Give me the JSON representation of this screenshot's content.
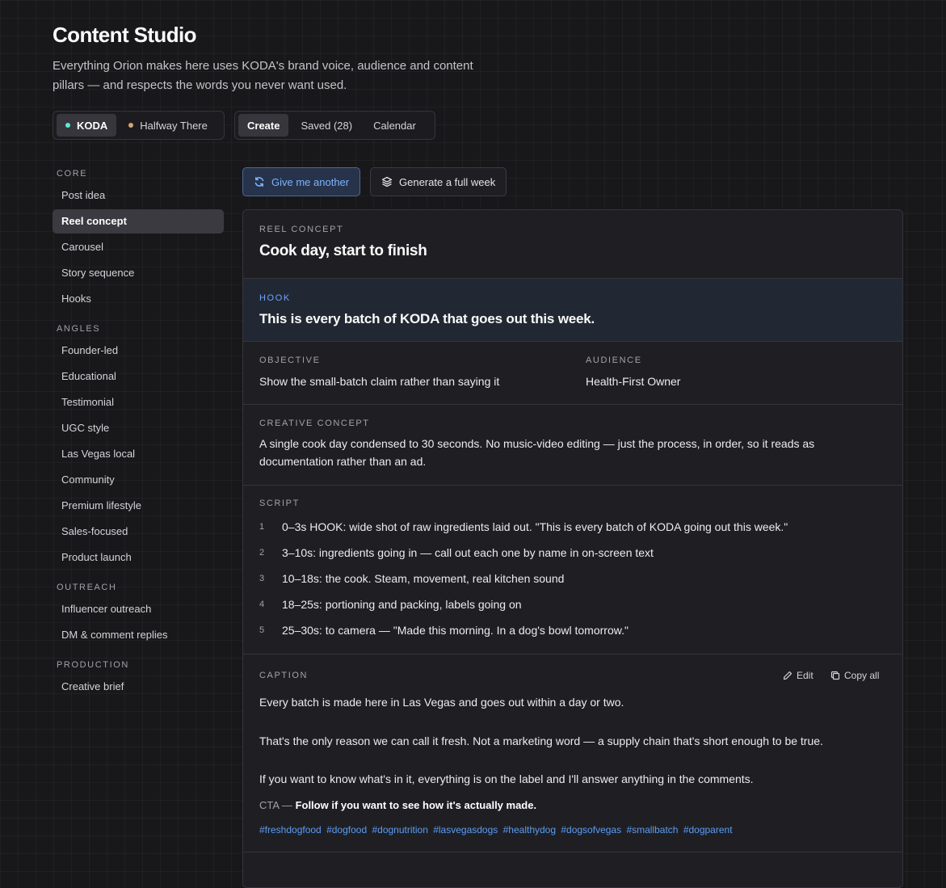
{
  "header": {
    "title": "Content Studio",
    "subtitle": "Everything Orion makes here uses KODA's brand voice, audience and content pillars — and respects the words you never want used."
  },
  "brands": [
    {
      "label": "KODA",
      "dot_color": "#5eead4",
      "active": true
    },
    {
      "label": "Halfway There",
      "dot_color": "#d4a574",
      "active": false
    }
  ],
  "view_tabs": [
    {
      "label": "Create",
      "active": true
    },
    {
      "label": "Saved (28)",
      "active": false
    },
    {
      "label": "Calendar",
      "active": false
    }
  ],
  "sidebar": {
    "groups": [
      {
        "heading": "CORE",
        "items": [
          {
            "label": "Post idea",
            "active": false
          },
          {
            "label": "Reel concept",
            "active": true
          },
          {
            "label": "Carousel",
            "active": false
          },
          {
            "label": "Story sequence",
            "active": false
          },
          {
            "label": "Hooks",
            "active": false
          }
        ]
      },
      {
        "heading": "ANGLES",
        "items": [
          {
            "label": "Founder-led",
            "active": false
          },
          {
            "label": "Educational",
            "active": false
          },
          {
            "label": "Testimonial",
            "active": false
          },
          {
            "label": "UGC style",
            "active": false
          },
          {
            "label": "Las Vegas local",
            "active": false
          },
          {
            "label": "Community",
            "active": false
          },
          {
            "label": "Premium lifestyle",
            "active": false
          },
          {
            "label": "Sales-focused",
            "active": false
          },
          {
            "label": "Product launch",
            "active": false
          }
        ]
      },
      {
        "heading": "OUTREACH",
        "items": [
          {
            "label": "Influencer outreach",
            "active": false
          },
          {
            "label": "DM & comment replies",
            "active": false
          }
        ]
      },
      {
        "heading": "PRODUCTION",
        "items": [
          {
            "label": "Creative brief",
            "active": false
          }
        ]
      }
    ]
  },
  "actions": {
    "give_another": "Give me another",
    "full_week": "Generate a full week"
  },
  "concept": {
    "type_label": "REEL CONCEPT",
    "title": "Cook day, start to finish",
    "hook_label": "HOOK",
    "hook": "This is every batch of KODA that goes out this week.",
    "objective_label": "OBJECTIVE",
    "objective": "Show the small-batch claim rather than saying it",
    "audience_label": "AUDIENCE",
    "audience": "Health-First Owner",
    "creative_label": "CREATIVE CONCEPT",
    "creative_lines": [
      "A single cook day condensed to 30 seconds. No music-video editing — just the process, in order, so it reads as",
      "documentation rather than an ad."
    ],
    "script_label": "SCRIPT",
    "script": [
      {
        "num": "1",
        "text": "0–3s HOOK: wide shot of raw ingredients laid out. \"This is every batch of KODA going out this week.\""
      },
      {
        "num": "2",
        "text": "3–10s: ingredients going in — call out each one by name in on-screen text"
      },
      {
        "num": "3",
        "text": "10–18s: the cook. Steam, movement, real kitchen sound"
      },
      {
        "num": "4",
        "text": "18–25s: portioning and packing, labels going on"
      },
      {
        "num": "5",
        "text": "25–30s: to camera — \"Made this morning. In a dog's bowl tomorrow.\""
      }
    ],
    "caption_label": "CAPTION",
    "edit_label": "Edit",
    "copy_label": "Copy all",
    "caption_paragraphs": [
      "Every batch is made here in Las Vegas and goes out within a day or two.",
      "That's the only reason we can call it fresh. Not a marketing word — a supply chain that's short enough to be true.",
      "If you want to know what's in it, everything is on the label and I'll answer anything in the comments."
    ],
    "cta_prefix": "CTA —",
    "cta": "Follow if you want to see how it's actually made.",
    "hashtags": [
      "#freshdogfood",
      "#dogfood",
      "#dognutrition",
      "#lasvegasdogs",
      "#healthydog",
      "#dogsofvegas",
      "#smallbatch",
      "#dogparent"
    ]
  }
}
